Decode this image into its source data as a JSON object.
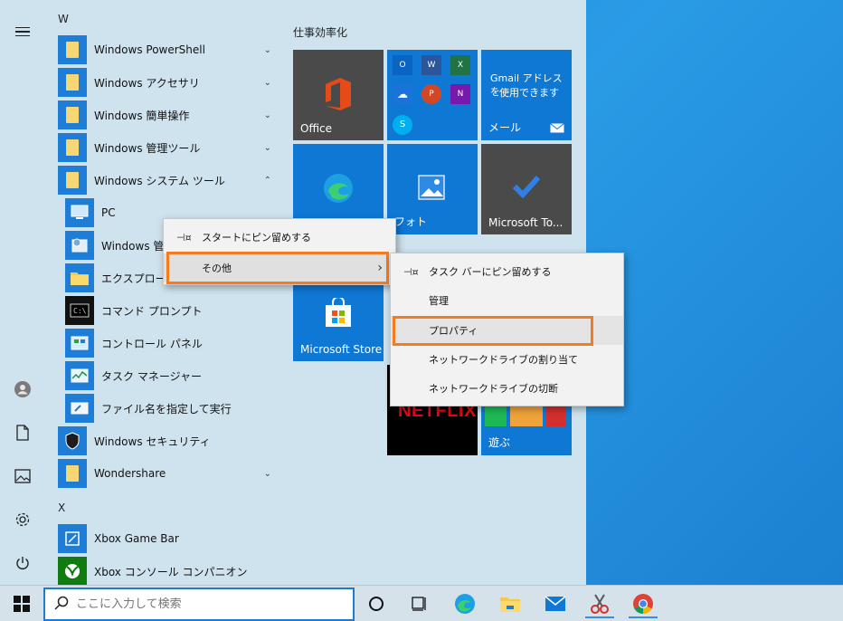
{
  "applist": {
    "letter_w": "W",
    "letter_x": "X",
    "items": [
      {
        "label": "Windows PowerShell"
      },
      {
        "label": "Windows アクセサリ"
      },
      {
        "label": "Windows 簡単操作"
      },
      {
        "label": "Windows 管理ツール"
      },
      {
        "label": "Windows システム ツール"
      },
      {
        "label": "PC"
      },
      {
        "label": "Windows 管"
      },
      {
        "label": "エクスプローラー"
      },
      {
        "label": "コマンド プロンプト"
      },
      {
        "label": "コントロール パネル"
      },
      {
        "label": "タスク マネージャー"
      },
      {
        "label": "ファイル名を指定して実行"
      },
      {
        "label": "Windows セキュリティ"
      },
      {
        "label": "Wondershare"
      },
      {
        "label": "Xbox Game Bar"
      },
      {
        "label": "Xbox コンソール コンパニオン"
      }
    ]
  },
  "tiles": {
    "group_title": "仕事効率化",
    "office": "Office",
    "gmail_line1": "Gmail アドレスを",
    "gmail_line2": "使用できます",
    "mail": "メール",
    "photos": "フォト",
    "todo": "Microsoft To...",
    "store": "Microsoft Store",
    "netflix": "NETFLIX",
    "play": "遊ぶ"
  },
  "context_menu_1": {
    "pin_start": "スタートにピン留めする",
    "more": "その他"
  },
  "context_menu_2": {
    "pin_taskbar": "タスク バーにピン留めする",
    "manage": "管理",
    "properties": "プロパティ",
    "map_drive": "ネットワークドライブの割り当て",
    "disconnect_drive": "ネットワークドライブの切断"
  },
  "taskbar": {
    "search_placeholder": "ここに入力して検索"
  },
  "colors": {
    "accent": "#f47b20",
    "tile_blue": "#0f78d4",
    "tile_dark": "#4a4a4a",
    "start_bg": "#cfe3ef"
  }
}
